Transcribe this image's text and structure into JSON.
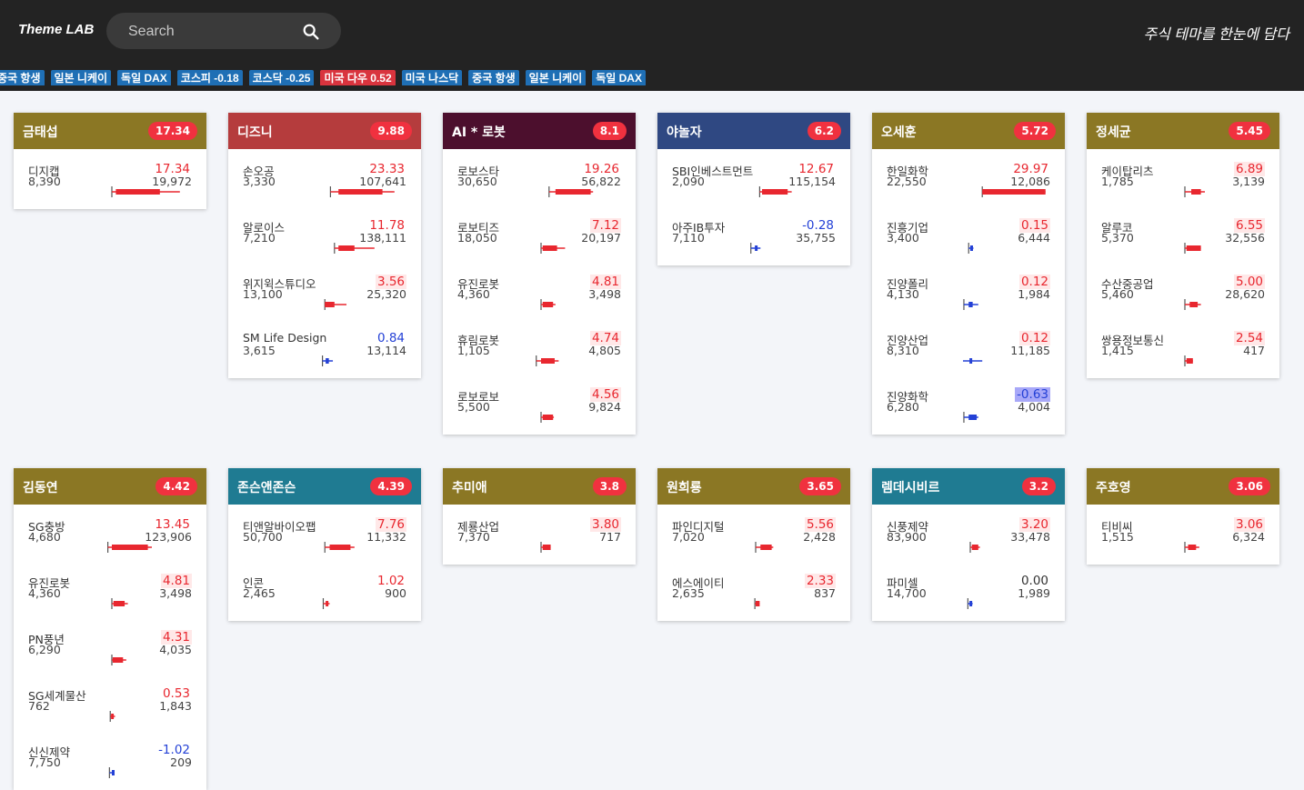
{
  "header": {
    "logo": "Theme LAB",
    "search_placeholder": "Search",
    "tagline": "주식 테마를 한눈에 담다"
  },
  "ticker": [
    {
      "label": "중국 항생",
      "color": "blue"
    },
    {
      "label": "일본 니케이",
      "color": "blue"
    },
    {
      "label": "독일 DAX",
      "color": "blue"
    },
    {
      "label": "코스피 -0.18",
      "color": "blue"
    },
    {
      "label": "코스닥 -0.25",
      "color": "blue"
    },
    {
      "label": "미국 다우 0.52",
      "color": "red"
    },
    {
      "label": "미국 나스닥",
      "color": "blue"
    },
    {
      "label": "중국 항생",
      "color": "blue"
    },
    {
      "label": "일본 니케이",
      "color": "blue"
    },
    {
      "label": "독일 DAX",
      "color": "blue"
    }
  ],
  "colors": {
    "gold": "#8b7724",
    "red": "#b53c3d",
    "maroon": "#4c0f2d",
    "navy": "#2f4882",
    "teal": "#1f7b92",
    "up": "#e8272f",
    "down": "#2441d6",
    "badge": "#f0313f"
  },
  "themes": [
    {
      "title": "금태섭",
      "score": "17.34",
      "color": "gold",
      "stocks": [
        {
          "name": "디지캡",
          "price": "8,390",
          "change": "17.34",
          "volume": "19,972",
          "dir": "up",
          "bar": {
            "lo": 0.0,
            "hi": 0.85,
            "o": 0.05,
            "c": 0.6
          }
        }
      ]
    },
    {
      "title": "디즈니",
      "score": "9.88",
      "color": "red",
      "stocks": [
        {
          "name": "손오공",
          "price": "3,330",
          "change": "23.33",
          "volume": "107,641",
          "dir": "up",
          "bar": {
            "lo": 0.05,
            "hi": 0.85,
            "o": 0.15,
            "c": 0.7
          }
        },
        {
          "name": "알로이스",
          "price": "7,210",
          "change": "11.78",
          "volume": "138,111",
          "dir": "up",
          "bar": {
            "lo": 0.1,
            "hi": 0.6,
            "o": 0.15,
            "c": 0.35
          }
        },
        {
          "name": "위지윅스튜디오",
          "price": "13,100",
          "change": "3.56",
          "volume": "25,320",
          "dir": "up",
          "bar": {
            "lo": -0.02,
            "hi": 0.25,
            "o": -0.02,
            "c": 0.1
          }
        },
        {
          "name": "SM Life Design",
          "price": "3,615",
          "change": "0.84",
          "volume": "13,114",
          "dir": "down",
          "bar": {
            "lo": -0.05,
            "hi": 0.08,
            "o": -0.01,
            "c": 0.03
          }
        }
      ]
    },
    {
      "title": "AI * 로봇",
      "score": "8.1",
      "color": "maroon",
      "stocks": [
        {
          "name": "로보스타",
          "price": "30,650",
          "change": "19.26",
          "volume": "56,822",
          "dir": "up",
          "bar": {
            "lo": 0.1,
            "hi": 0.65,
            "o": 0.18,
            "c": 0.62
          }
        },
        {
          "name": "로보티즈",
          "price": "18,050",
          "change": "7.12",
          "volume": "20,197",
          "dir": "up",
          "bar": {
            "lo": 0.0,
            "hi": 0.3,
            "o": 0.02,
            "c": 0.2
          }
        },
        {
          "name": "유진로봇",
          "price": "4,360",
          "change": "4.81",
          "volume": "3,498",
          "dir": "up",
          "bar": {
            "lo": 0.0,
            "hi": 0.18,
            "o": 0.02,
            "c": 0.15
          }
        },
        {
          "name": "휴림로봇",
          "price": "1,105",
          "change": "4.74",
          "volume": "4,805",
          "dir": "up",
          "bar": {
            "lo": -0.06,
            "hi": 0.22,
            "o": 0.0,
            "c": 0.17
          }
        },
        {
          "name": "로보로보",
          "price": "5,500",
          "change": "4.56",
          "volume": "9,824",
          "dir": "up",
          "bar": {
            "lo": 0.0,
            "hi": 0.16,
            "o": 0.02,
            "c": 0.15
          }
        }
      ]
    },
    {
      "title": "야놀자",
      "score": "6.2",
      "color": "navy",
      "stocks": [
        {
          "name": "SBI인베스트먼트",
          "price": "2,090",
          "change": "12.67",
          "volume": "115,154",
          "dir": "up",
          "bar": {
            "lo": 0.05,
            "hi": 0.45,
            "o": 0.08,
            "c": 0.4
          }
        },
        {
          "name": "아주IB투자",
          "price": "7,110",
          "change": "-0.28",
          "volume": "35,755",
          "dir": "down",
          "bar": {
            "lo": -0.06,
            "hi": 0.06,
            "o": -0.01,
            "c": 0.01
          }
        }
      ]
    },
    {
      "title": "오세훈",
      "score": "5.72",
      "color": "gold",
      "stocks": [
        {
          "name": "한일화학",
          "price": "22,550",
          "change": "29.97",
          "volume": "12,086",
          "dir": "up",
          "bar": {
            "lo": 0.15,
            "hi": 0.94,
            "o": 0.15,
            "c": 0.94
          }
        },
        {
          "name": "진흥기업",
          "price": "3,400",
          "change": "0.15",
          "volume": "6,444",
          "dir": "down",
          "bar": {
            "lo": -0.02,
            "hi": 0.04,
            "o": 0.0,
            "c": 0.01
          }
        },
        {
          "name": "진양폴리",
          "price": "4,130",
          "change": "0.12",
          "volume": "1,984",
          "dir": "down",
          "bar": {
            "lo": -0.08,
            "hi": 0.1,
            "o": -0.02,
            "c": 0.03
          }
        },
        {
          "name": "진양산업",
          "price": "8,310",
          "change": "0.12",
          "volume": "11,185",
          "dir": "down",
          "bar": {
            "lo": -0.15,
            "hi": 0.15,
            "o": -0.01,
            "c": 0.01
          }
        },
        {
          "name": "진양화학",
          "price": "6,280",
          "change": "-0.63",
          "volume": "4,004",
          "dir": "down",
          "bar": {
            "lo": -0.08,
            "hi": 0.1,
            "o": -0.02,
            "c": 0.08
          }
        }
      ]
    },
    {
      "title": "정세균",
      "score": "5.45",
      "color": "gold",
      "stocks": [
        {
          "name": "케이탑리츠",
          "price": "1,785",
          "change": "6.89",
          "volume": "3,139",
          "dir": "up",
          "bar": {
            "lo": 0.0,
            "hi": 0.25,
            "o": 0.08,
            "c": 0.2
          }
        },
        {
          "name": "알루코",
          "price": "5,370",
          "change": "6.55",
          "volume": "32,556",
          "dir": "up",
          "bar": {
            "lo": 0.0,
            "hi": 0.2,
            "o": 0.02,
            "c": 0.2
          }
        },
        {
          "name": "수산중공업",
          "price": "5,460",
          "change": "5.00",
          "volume": "28,620",
          "dir": "up",
          "bar": {
            "lo": 0.0,
            "hi": 0.2,
            "o": 0.06,
            "c": 0.16
          }
        },
        {
          "name": "쌍용정보통신",
          "price": "1,415",
          "change": "2.54",
          "volume": "417",
          "dir": "up",
          "bar": {
            "lo": 0.0,
            "hi": 0.1,
            "o": 0.02,
            "c": 0.1
          }
        }
      ]
    },
    {
      "title": "김동연",
      "score": "4.42",
      "color": "gold",
      "stocks": [
        {
          "name": "SG충방",
          "price": "4,680",
          "change": "13.45",
          "volume": "123,906",
          "dir": "up",
          "bar": {
            "lo": -0.05,
            "hi": 0.5,
            "o": 0.0,
            "c": 0.45
          }
        },
        {
          "name": "유진로봇",
          "price": "4,360",
          "change": "4.81",
          "volume": "3,498",
          "dir": "up",
          "bar": {
            "lo": 0.0,
            "hi": 0.2,
            "o": 0.02,
            "c": 0.16
          }
        },
        {
          "name": "PN풍년",
          "price": "6,290",
          "change": "4.31",
          "volume": "4,035",
          "dir": "up",
          "bar": {
            "lo": 0.0,
            "hi": 0.18,
            "o": 0.01,
            "c": 0.14
          }
        },
        {
          "name": "SG세계물산",
          "price": "762",
          "change": "0.53",
          "volume": "1,843",
          "dir": "up",
          "bar": {
            "lo": -0.02,
            "hi": 0.04,
            "o": -0.01,
            "c": 0.02
          }
        },
        {
          "name": "신신제약",
          "price": "7,750",
          "change": "-1.02",
          "volume": "209",
          "dir": "down",
          "bar": {
            "lo": -0.03,
            "hi": 0.03,
            "o": 0.0,
            "c": 0.02
          }
        }
      ]
    },
    {
      "title": "존슨앤존슨",
      "score": "4.39",
      "color": "teal",
      "stocks": [
        {
          "name": "티앤알바이오팹",
          "price": "50,700",
          "change": "7.76",
          "volume": "11,332",
          "dir": "up",
          "bar": {
            "lo": -0.02,
            "hi": 0.35,
            "o": 0.04,
            "c": 0.3
          }
        },
        {
          "name": "인콘",
          "price": "2,465",
          "change": "1.02",
          "volume": "900",
          "dir": "up",
          "bar": {
            "lo": -0.04,
            "hi": 0.04,
            "o": -0.01,
            "c": 0.01
          }
        }
      ]
    },
    {
      "title": "추미애",
      "score": "3.8",
      "color": "gold",
      "stocks": [
        {
          "name": "제룡산업",
          "price": "7,370",
          "change": "3.80",
          "volume": "717",
          "dir": "up",
          "bar": {
            "lo": 0.0,
            "hi": 0.12,
            "o": 0.02,
            "c": 0.12
          }
        }
      ]
    },
    {
      "title": "원희룡",
      "score": "3.65",
      "color": "gold",
      "stocks": [
        {
          "name": "파인디지털",
          "price": "7,020",
          "change": "5.56",
          "volume": "2,428",
          "dir": "up",
          "bar": {
            "lo": 0.0,
            "hi": 0.22,
            "o": 0.06,
            "c": 0.2
          }
        },
        {
          "name": "에스에이티",
          "price": "2,635",
          "change": "2.33",
          "volume": "837",
          "dir": "up",
          "bar": {
            "lo": -0.01,
            "hi": 0.05,
            "o": 0.0,
            "c": 0.05
          }
        }
      ]
    },
    {
      "title": "렘데시비르",
      "score": "3.2",
      "color": "teal",
      "stocks": [
        {
          "name": "신풍제약",
          "price": "83,900",
          "change": "3.20",
          "volume": "33,478",
          "dir": "up",
          "bar": {
            "lo": 0.0,
            "hi": 0.12,
            "o": 0.02,
            "c": 0.1
          }
        },
        {
          "name": "파미셀",
          "price": "14,700",
          "change": "0.00",
          "volume": "1,989",
          "dir": "flat",
          "bar": {
            "lo": -0.03,
            "hi": 0.03,
            "o": -0.01,
            "c": 0.01
          }
        }
      ]
    },
    {
      "title": "주호영",
      "score": "3.06",
      "color": "gold",
      "stocks": [
        {
          "name": "티비씨",
          "price": "1,515",
          "change": "3.06",
          "volume": "6,324",
          "dir": "up",
          "bar": {
            "lo": 0.0,
            "hi": 0.18,
            "o": 0.04,
            "c": 0.14
          }
        }
      ]
    }
  ]
}
